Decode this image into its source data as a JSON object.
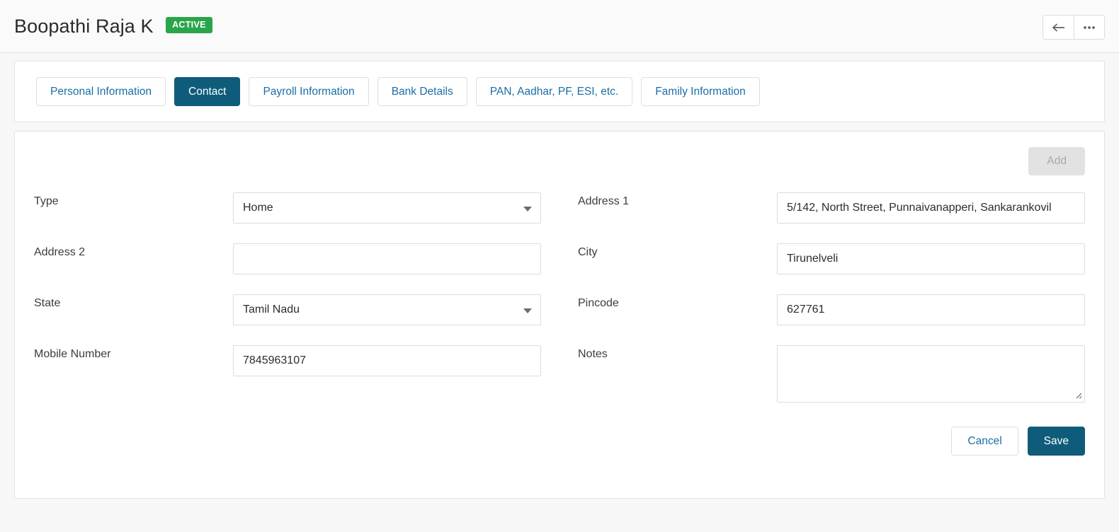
{
  "header": {
    "title": "Boopathi Raja K",
    "status": "ACTIVE",
    "status_color": "#2aa549",
    "back_icon": "arrow-left-icon",
    "more_icon": "ellipsis-icon"
  },
  "tabs": [
    {
      "label": "Personal Information",
      "active": false
    },
    {
      "label": "Contact",
      "active": true
    },
    {
      "label": "Payroll Information",
      "active": false
    },
    {
      "label": "Bank Details",
      "active": false
    },
    {
      "label": "PAN, Aadhar, PF, ESI, etc.",
      "active": false
    },
    {
      "label": "Family Information",
      "active": false
    }
  ],
  "toolbar": {
    "add_label": "Add",
    "add_disabled": true
  },
  "form": {
    "left": [
      {
        "label": "Type",
        "value": "Home",
        "placeholder": "",
        "kind": "select"
      },
      {
        "label": "Address 2",
        "value": "",
        "placeholder": "",
        "kind": "text"
      },
      {
        "label": "State",
        "value": "Tamil Nadu",
        "placeholder": "",
        "kind": "select"
      },
      {
        "label": "Mobile Number",
        "value": "7845963107",
        "placeholder": "",
        "kind": "text"
      }
    ],
    "right": [
      {
        "label": "Address 1",
        "value": "5/142, North Street, Punnaivanapperi, Sankarankovil",
        "placeholder": "",
        "kind": "text"
      },
      {
        "label": "City",
        "value": "Tirunelveli",
        "placeholder": "",
        "kind": "text"
      },
      {
        "label": "Pincode",
        "value": "627761",
        "placeholder": "",
        "kind": "text"
      },
      {
        "label": "Notes",
        "value": "",
        "placeholder": "",
        "kind": "textarea"
      }
    ]
  },
  "footer": {
    "cancel_label": "Cancel",
    "save_label": "Save"
  },
  "theme": {
    "accent": "#0e5c7a",
    "link": "#1b6ea5",
    "page_bg": "#f7f7f7"
  }
}
